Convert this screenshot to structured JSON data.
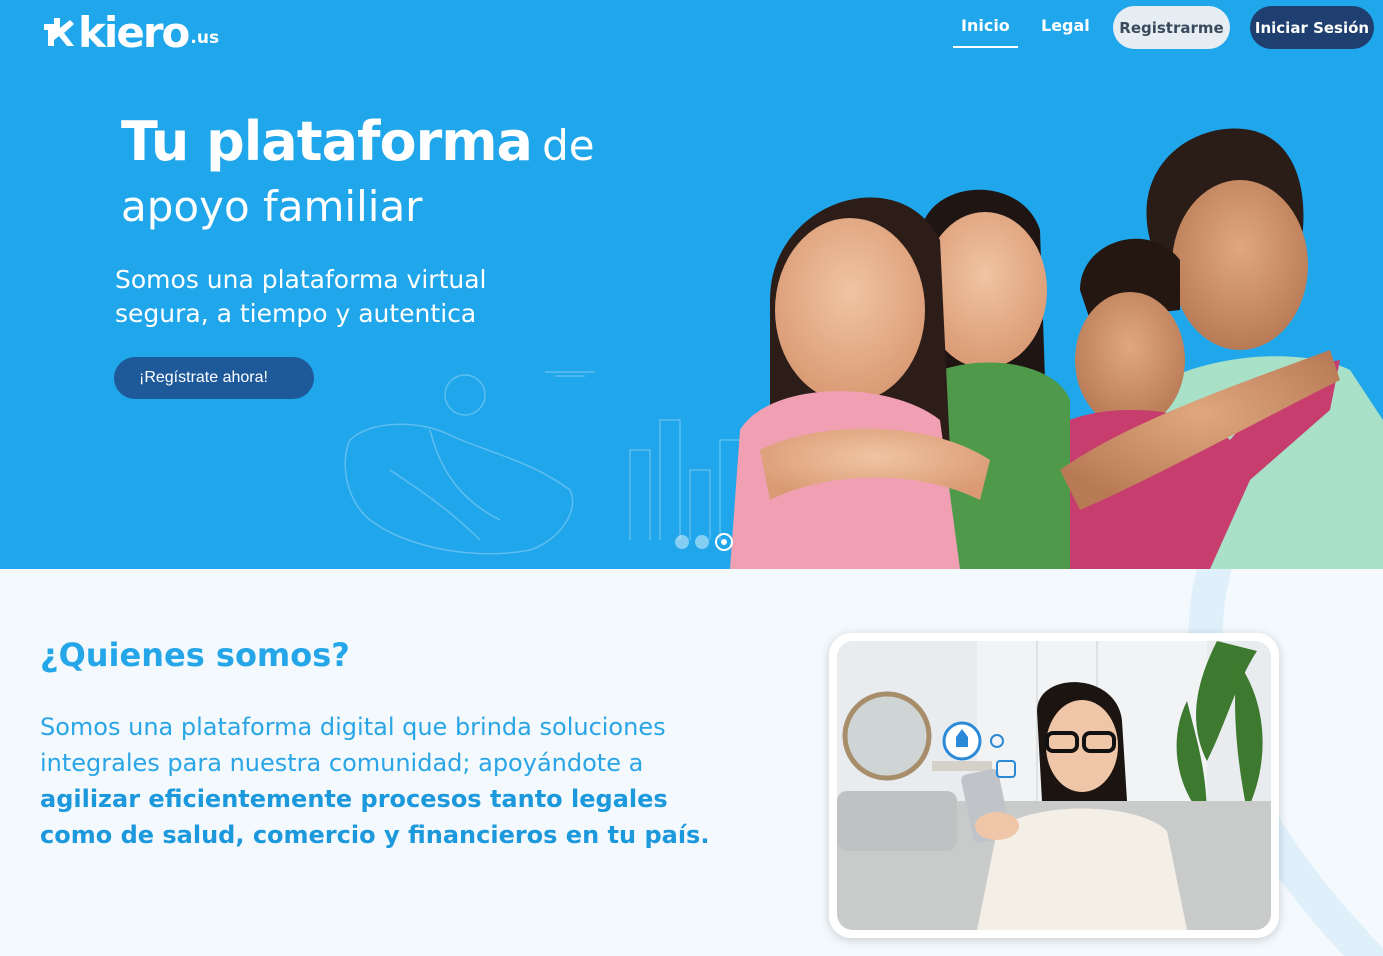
{
  "header": {
    "logo_word": "kiero",
    "logo_suffix": ".us",
    "nav": {
      "inicio": "Inicio",
      "legal": "Legal"
    },
    "register_label": "Registrarme",
    "login_label": "Iniciar Sesión"
  },
  "hero": {
    "title_strong": "Tu plataforma",
    "title_light_1": "de",
    "title_light_2": "apoyo familiar",
    "subtitle": "Somos una plataforma virtual segura, a tiempo y autentica",
    "cta_label": "¡Regístrate ahora!",
    "carousel": {
      "slides": 3,
      "active_index": 2
    }
  },
  "about": {
    "title": "¿Quienes somos?",
    "text_regular": "Somos una plataforma digital que brinda soluciones integrales para nuestra comunidad; apoyándote a ",
    "text_bold": "agilizar eficientemente procesos tanto legales como de salud, comercio y financieros en tu país."
  },
  "colors": {
    "hero_bg": "#20a6ea",
    "accent": "#24a6e8",
    "login_button": "#1e3f6f",
    "cta_button": "#1e5a9a",
    "section_bg": "#f3f9fd"
  }
}
